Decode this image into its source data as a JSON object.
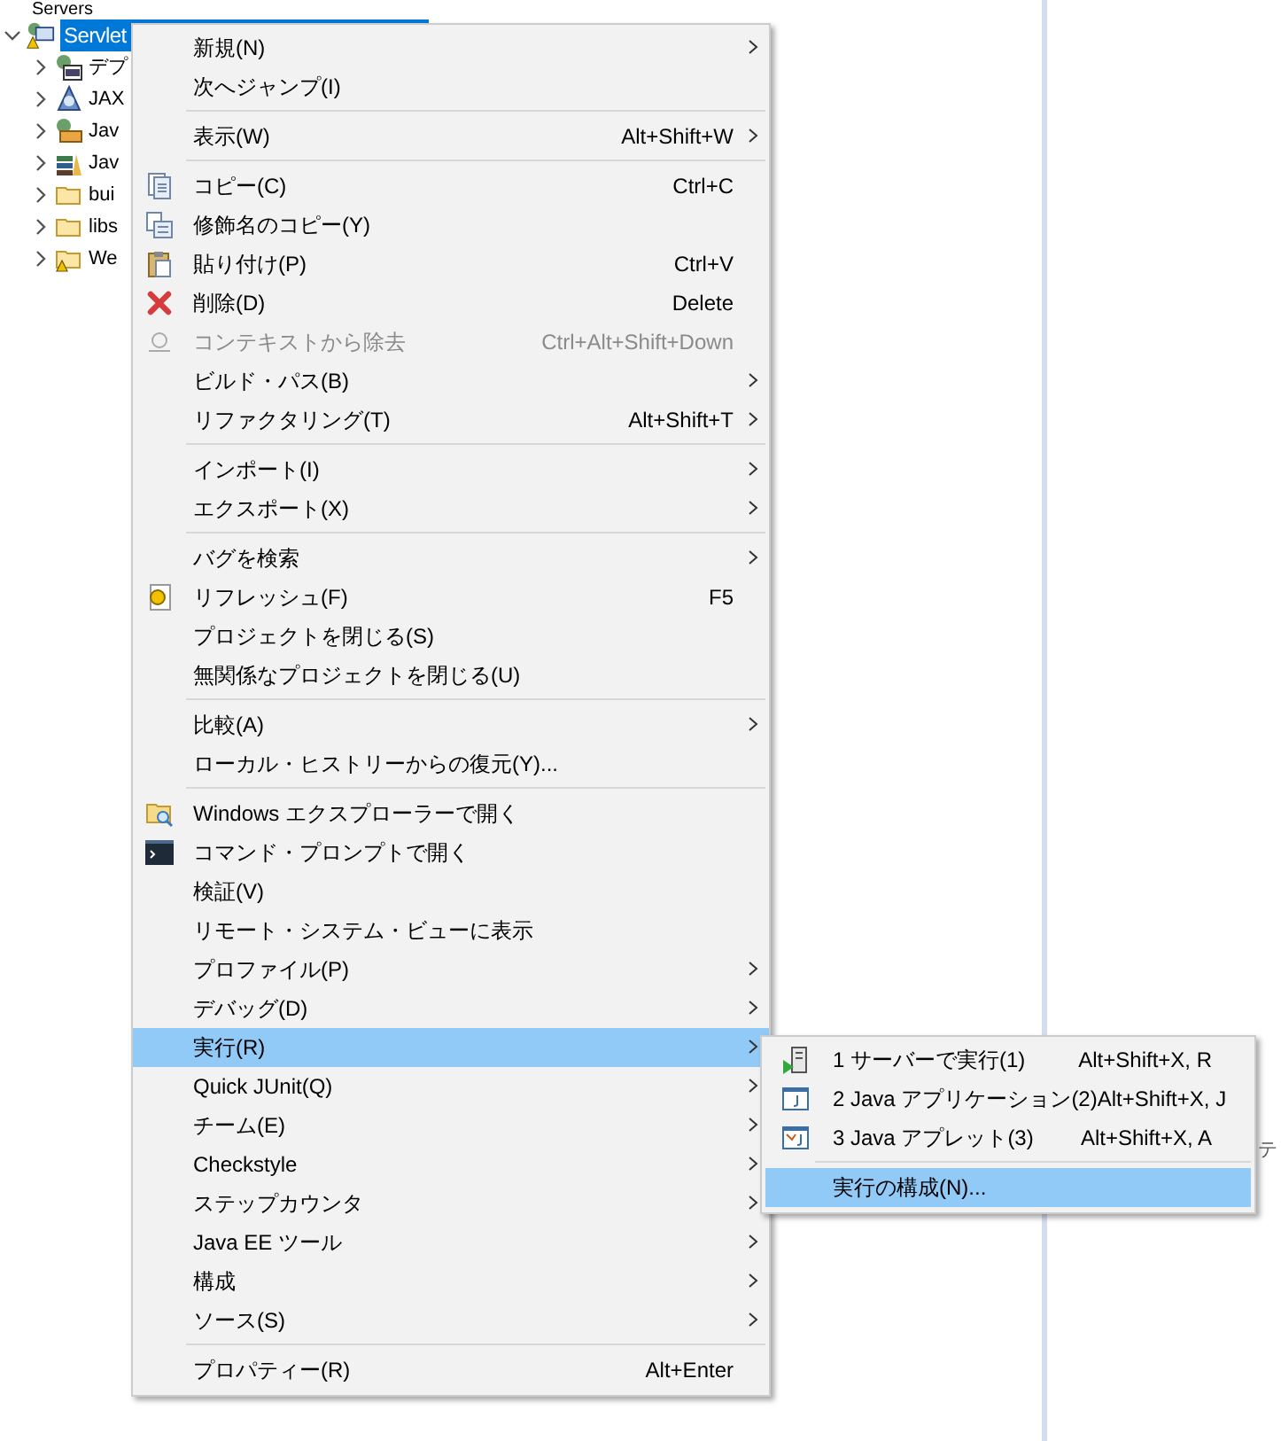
{
  "tree": {
    "top_item": "Servers",
    "project": {
      "label": "Servlet",
      "selected": true,
      "expanded": true
    },
    "children": [
      {
        "label": "デプ"
      },
      {
        "label": "JAX"
      },
      {
        "label": "Jav"
      },
      {
        "label": "Jav"
      },
      {
        "label": "bui"
      },
      {
        "label": "libs"
      },
      {
        "label": "We"
      }
    ]
  },
  "right_panel": {
    "fragment": "テ"
  },
  "context_menu": {
    "groups": [
      [
        {
          "label": "新規(N)",
          "submenu": true,
          "disabled": false,
          "selected": false
        },
        {
          "label": "次へジャンプ(I)",
          "submenu": false,
          "disabled": false,
          "selected": false
        }
      ],
      [
        {
          "label": "表示(W)",
          "shortcut": "Alt+Shift+W",
          "submenu": true,
          "disabled": false,
          "selected": false
        }
      ],
      [
        {
          "label": "コピー(C)",
          "shortcut": "Ctrl+C",
          "submenu": false,
          "disabled": false,
          "selected": false
        },
        {
          "label": "修飾名のコピー(Y)",
          "submenu": false,
          "disabled": false,
          "selected": false
        },
        {
          "label": "貼り付け(P)",
          "shortcut": "Ctrl+V",
          "submenu": false,
          "disabled": false,
          "selected": false
        },
        {
          "label": "削除(D)",
          "shortcut": "Delete",
          "submenu": false,
          "disabled": false,
          "selected": false
        },
        {
          "label": "コンテキストから除去",
          "shortcut": "Ctrl+Alt+Shift+Down",
          "submenu": false,
          "disabled": true,
          "selected": false
        },
        {
          "label": "ビルド・パス(B)",
          "submenu": true,
          "disabled": false,
          "selected": false
        },
        {
          "label": "リファクタリング(T)",
          "shortcut": "Alt+Shift+T",
          "submenu": true,
          "disabled": false,
          "selected": false
        }
      ],
      [
        {
          "label": "インポート(I)",
          "submenu": true,
          "disabled": false,
          "selected": false
        },
        {
          "label": "エクスポート(X)",
          "submenu": true,
          "disabled": false,
          "selected": false
        }
      ],
      [
        {
          "label": "バグを検索",
          "submenu": true,
          "disabled": false,
          "selected": false
        },
        {
          "label": "リフレッシュ(F)",
          "shortcut": "F5",
          "submenu": false,
          "disabled": false,
          "selected": false
        },
        {
          "label": "プロジェクトを閉じる(S)",
          "submenu": false,
          "disabled": false,
          "selected": false
        },
        {
          "label": "無関係なプロジェクトを閉じる(U)",
          "submenu": false,
          "disabled": false,
          "selected": false
        }
      ],
      [
        {
          "label": "比較(A)",
          "submenu": true,
          "disabled": false,
          "selected": false
        },
        {
          "label": "ローカル・ヒストリーからの復元(Y)...",
          "submenu": false,
          "disabled": false,
          "selected": false
        }
      ],
      [
        {
          "label": "Windows エクスプローラーで開く",
          "submenu": false,
          "disabled": false,
          "selected": false
        },
        {
          "label": "コマンド・プロンプトで開く",
          "submenu": false,
          "disabled": false,
          "selected": false
        },
        {
          "label": "検証(V)",
          "submenu": false,
          "disabled": false,
          "selected": false
        },
        {
          "label": "リモート・システム・ビューに表示",
          "submenu": false,
          "disabled": false,
          "selected": false
        },
        {
          "label": "プロファイル(P)",
          "submenu": true,
          "disabled": false,
          "selected": false
        },
        {
          "label": "デバッグ(D)",
          "submenu": true,
          "disabled": false,
          "selected": false
        },
        {
          "label": "実行(R)",
          "submenu": true,
          "disabled": false,
          "selected": true
        },
        {
          "label": "Quick JUnit(Q)",
          "submenu": true,
          "disabled": false,
          "selected": false
        },
        {
          "label": "チーム(E)",
          "submenu": true,
          "disabled": false,
          "selected": false
        },
        {
          "label": "Checkstyle",
          "submenu": true,
          "disabled": false,
          "selected": false
        },
        {
          "label": "ステップカウンタ",
          "submenu": true,
          "disabled": false,
          "selected": false
        },
        {
          "label": "Java EE ツール",
          "submenu": true,
          "disabled": false,
          "selected": false
        },
        {
          "label": "構成",
          "submenu": true,
          "disabled": false,
          "selected": false
        },
        {
          "label": "ソース(S)",
          "submenu": true,
          "disabled": false,
          "selected": false
        }
      ],
      [
        {
          "label": "プロパティー(R)",
          "shortcut": "Alt+Enter",
          "submenu": false,
          "disabled": false,
          "selected": false
        }
      ]
    ]
  },
  "submenu": {
    "groups": [
      [
        {
          "label": "1 サーバーで実行(1)",
          "shortcut": "Alt+Shift+X, R",
          "selected": false
        },
        {
          "label": "2 Java アプリケーション(2)",
          "shortcut": "Alt+Shift+X, J",
          "selected": false
        },
        {
          "label": "3 Java アプレット(3)",
          "shortcut": "Alt+Shift+X, A",
          "selected": false
        }
      ],
      [
        {
          "label": "実行の構成(N)...",
          "selected": true
        }
      ]
    ]
  }
}
